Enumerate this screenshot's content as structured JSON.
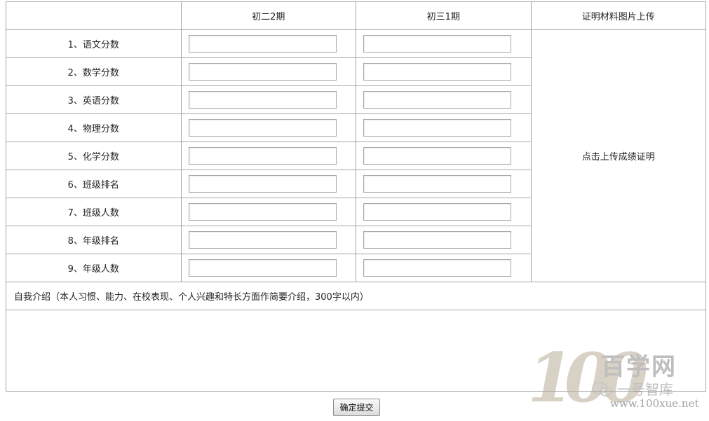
{
  "header": {
    "col1": "初二2期",
    "col2": "初三1期",
    "col3": "证明材料图片上传"
  },
  "rows": [
    {
      "label": "1、语文分数"
    },
    {
      "label": "2、数学分数"
    },
    {
      "label": "3、英语分数"
    },
    {
      "label": "4、物理分数"
    },
    {
      "label": "5、化学分数"
    },
    {
      "label": "6、班级排名"
    },
    {
      "label": "7、班级人数"
    },
    {
      "label": "8、年级排名"
    },
    {
      "label": "9、年级人数"
    }
  ],
  "upload": {
    "label": "点击上传成绩证明"
  },
  "intro": {
    "label": "自我介绍（本人习惯、能力、在校表现、个人兴趣和特长方面作简要介绍，300字以内）"
  },
  "submit": {
    "label": "确定提交"
  },
  "watermark": {
    "digits": "100",
    "brand": "百学网",
    "sub": "一号智库",
    "url": "www.100xue.net"
  }
}
